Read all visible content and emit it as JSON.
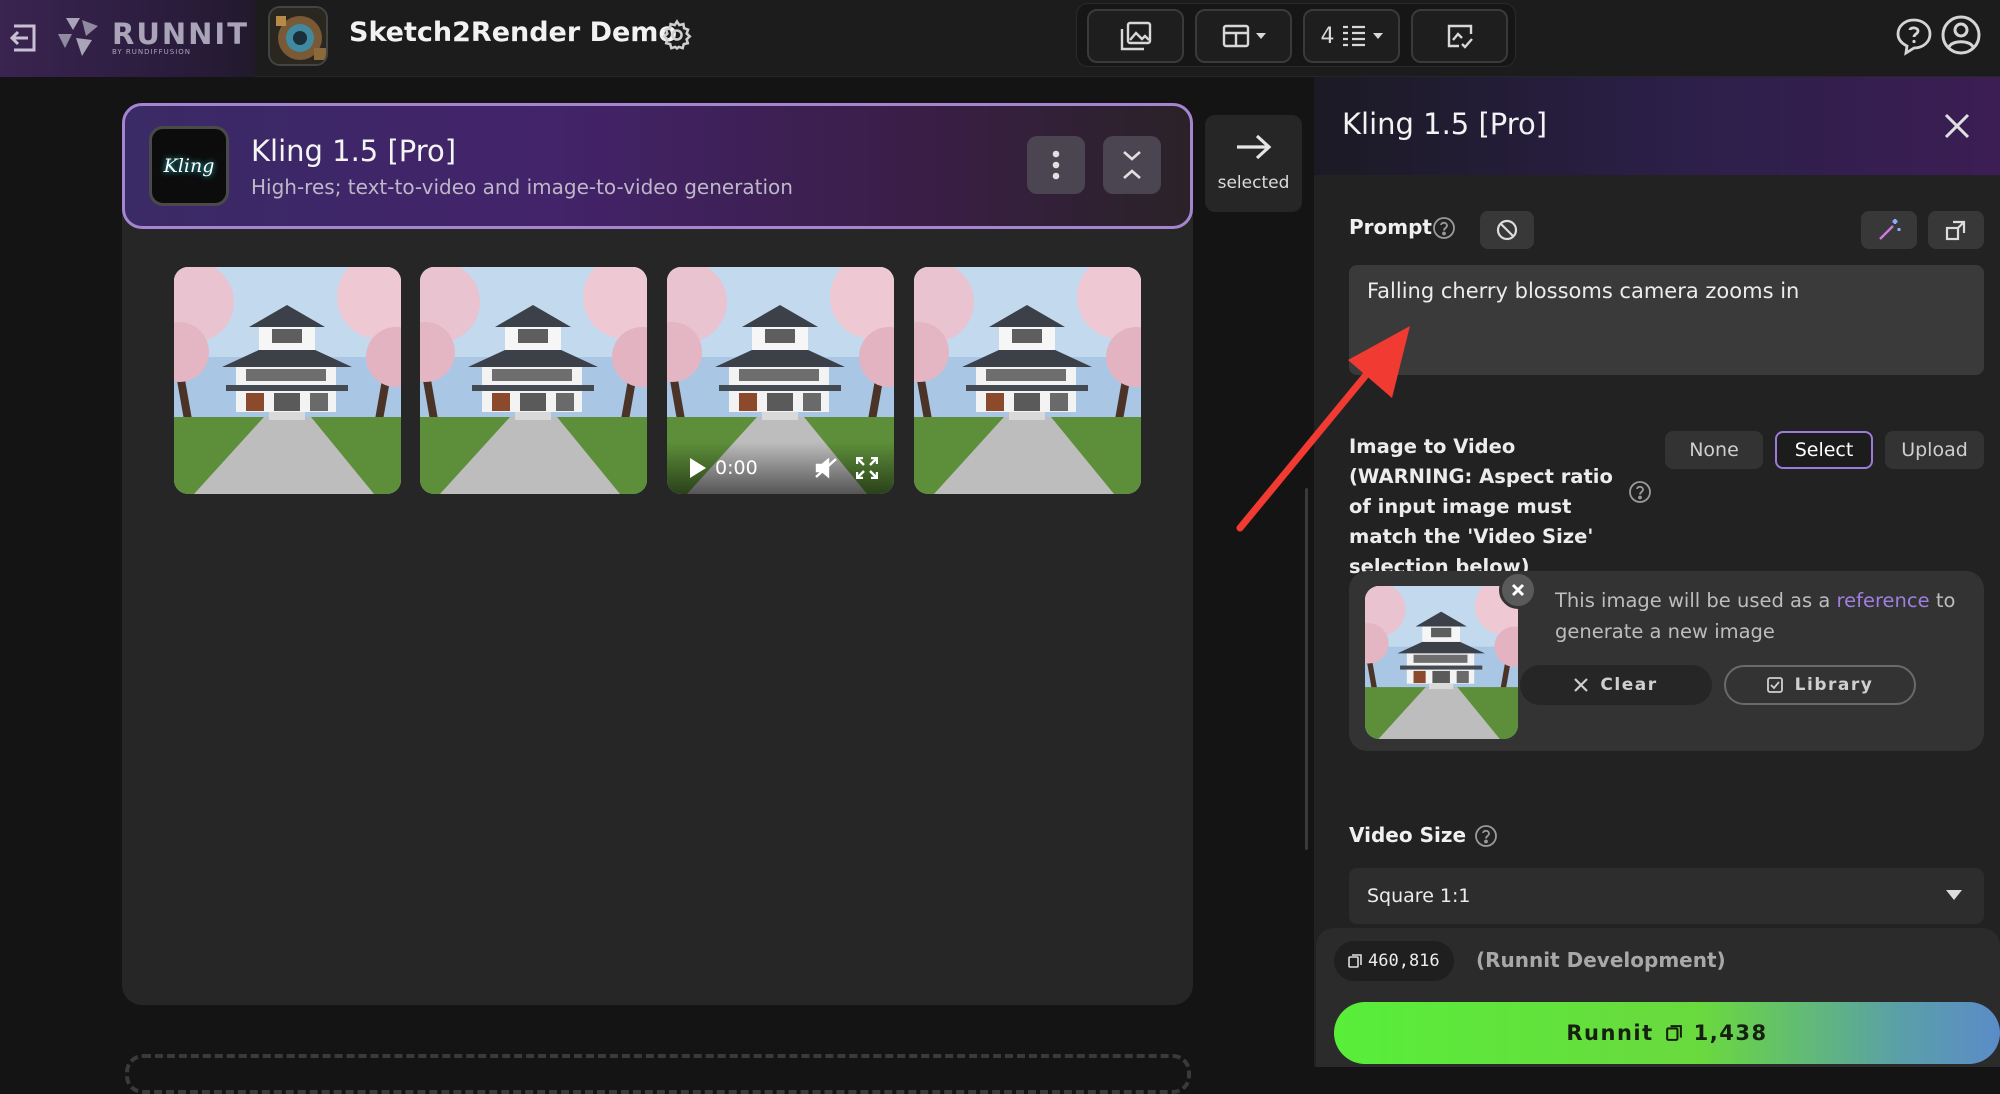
{
  "app": {
    "logo_text": "RUNNIT",
    "logo_subtext": "BY RUNDIFFUSION",
    "project_title": "Sketch2Render Demo"
  },
  "toolbar": {
    "count_label": "4"
  },
  "node": {
    "logo_text": "Kling",
    "title": "Kling 1.5 [Pro]",
    "subtitle": "High-res; text-to-video and image-to-video generation",
    "video_time": "0:00"
  },
  "selected_label": "selected",
  "panel": {
    "title": "Kling 1.5 [Pro]",
    "prompt_label": "Prompt",
    "prompt_value": "Falling cherry blossoms camera zooms in",
    "itv_label": "Image to Video (WARNING: Aspect ratio of input image must match the 'Video Size' selection below)",
    "itv_options": [
      "None",
      "Select",
      "Upload"
    ],
    "itv_selected": "Select",
    "ref_text_before": "This image will be used as a",
    "ref_link": "reference",
    "ref_text_after": "to generate a new image",
    "clear_label": "Clear",
    "library_label": "Library",
    "video_size_label": "Video Size",
    "video_size_value": "Square 1:1"
  },
  "footer": {
    "credits": "460,816",
    "org": "(Runnit Development)",
    "run_label": "Runnit",
    "run_cost": "1,438"
  },
  "colors": {
    "accent_purple": "#a585d0",
    "run_green": "#58ee3a",
    "annotation_red": "#f03a32"
  }
}
